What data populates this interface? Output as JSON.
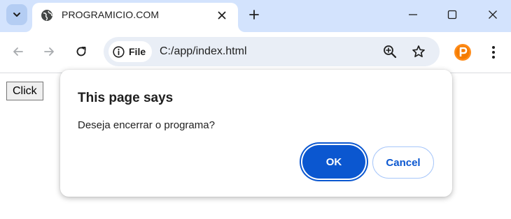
{
  "tab": {
    "title": "PROGRAMICIO.COM"
  },
  "address_bar": {
    "chip_label": "File",
    "url": "C:/app/index.html"
  },
  "page": {
    "button_label": "Click"
  },
  "dialog": {
    "title": "This page says",
    "message": "Deseja encerrar o programa?",
    "ok_label": "OK",
    "cancel_label": "Cancel"
  },
  "icons": {
    "tab_search": "chevron-down-icon",
    "favicon": "globe-icon",
    "tab_close": "close-icon",
    "new_tab": "plus-icon",
    "minimize": "minimize-icon",
    "maximize": "maximize-icon",
    "window_close": "close-icon",
    "back": "arrow-left-icon",
    "forward": "arrow-right-icon",
    "reload": "reload-icon",
    "site_info": "info-icon",
    "zoom": "zoom-in-icon",
    "bookmark": "star-icon",
    "extension": "extension-p-icon",
    "menu": "kebab-menu-icon"
  },
  "colors": {
    "tabstrip_bg": "#d3e3fd",
    "omnibox_bg": "#e9eef6",
    "accent": "#0b57d0",
    "extension": "#f57c00"
  }
}
